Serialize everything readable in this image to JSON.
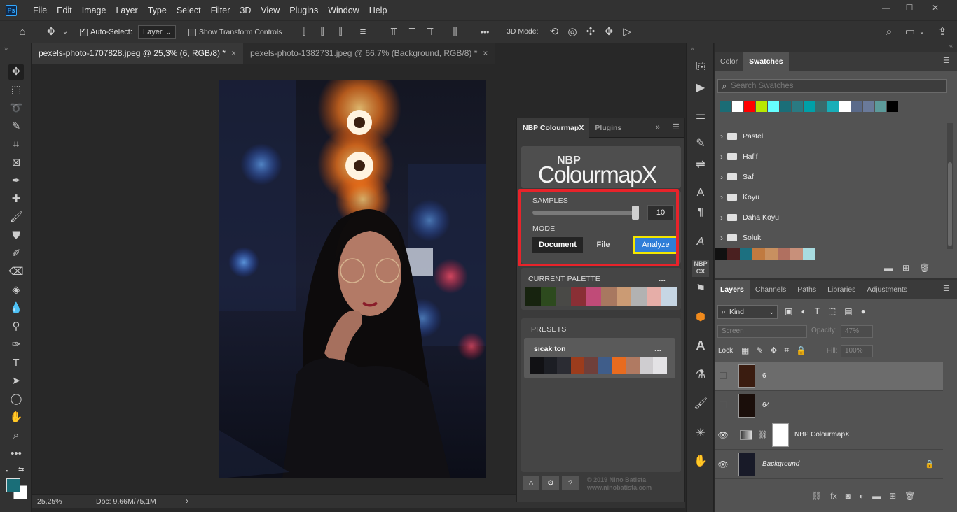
{
  "app": {
    "icon": "Ps"
  },
  "menu": [
    "File",
    "Edit",
    "Image",
    "Layer",
    "Type",
    "Select",
    "Filter",
    "3D",
    "View",
    "Plugins",
    "Window",
    "Help"
  ],
  "window_controls": {
    "minimize": "—",
    "maximize": "☐",
    "close": "✕"
  },
  "options_bar": {
    "auto_select_label": "Auto-Select:",
    "auto_select_value": "Layer",
    "show_transform_label": "Show Transform Controls",
    "mode_3d_label": "3D Mode:",
    "more": "•••"
  },
  "doc_tabs": [
    {
      "label": "pexels-photo-1707828.jpeg @ 25,3% (6, RGB/8) *",
      "close": "×",
      "active": true
    },
    {
      "label": "pexels-photo-1382731.jpeg @ 66,7% (Background, RGB/8) *",
      "close": "×",
      "active": false
    }
  ],
  "status": {
    "zoom": "25,25%",
    "doc": "Doc: 9,66M/75,1M",
    "arrow": "›"
  },
  "nbp_panel": {
    "tabs": [
      "NBP ColourmapX",
      "Plugins"
    ],
    "logo_small": "NBP",
    "logo_main": "ColourmapX",
    "samples_label": "SAMPLES",
    "samples_value": "10",
    "samples_fraction": 1.0,
    "mode_label": "MODE",
    "mode_document": "Document",
    "mode_file": "File",
    "analyze_button": "Analyze",
    "current_palette_label": "CURRENT PALETTE",
    "more": "...",
    "current_palette": [
      "#17230f",
      "#2d4a1e",
      "#494946",
      "#8a2f35",
      "#c04b78",
      "#a87860",
      "#cb9b74",
      "#b2b2b2",
      "#e6aea8",
      "#c6d6e4"
    ],
    "presets_label": "PRESETS",
    "preset_name": "sıcak ton",
    "preset_palette": [
      "#111114",
      "#1c1e24",
      "#2b2c33",
      "#9c3c1c",
      "#6f3f3a",
      "#3f5d8a",
      "#e86b1f",
      "#b07a62",
      "#cfcdd0",
      "#e3e2e5"
    ],
    "copyright_line1": "© 2019 Nino Batista",
    "copyright_line2": "www.ninobatista.com"
  },
  "colors": {
    "highlight_red": "#e8232a",
    "highlight_yellow": "#f3e600",
    "analyze_blue": "#2f7ed8",
    "foreground": "#1a6e78",
    "background_swatch": "#ffffff"
  },
  "swatches_panel": {
    "tabs": [
      "Color",
      "Swatches"
    ],
    "search_placeholder": "Search Swatches",
    "recent": [
      "#1b6c75",
      "#ffffff",
      "#ff0000",
      "#b8e800",
      "#66ffff",
      "#1a6e78",
      "#2a7a82",
      "#00a0a8",
      "#3a6a6c",
      "#18aeb8",
      "#ffffff",
      "#5a6a8a",
      "#6a7a9a",
      "#5c9a9a",
      "#000000"
    ],
    "folders": [
      "Pastel",
      "Hafif",
      "Saf",
      "Koyu",
      "Daha Koyu",
      "Soluk"
    ],
    "bottom_row": [
      "#111111",
      "#4a2020",
      "#1c7080",
      "#c07a40",
      "#c89060",
      "#b07060",
      "#c8907a",
      "#a8dce0"
    ]
  },
  "layers_panel": {
    "tabs": [
      "Layers",
      "Channels",
      "Paths",
      "Libraries",
      "Adjustments"
    ],
    "kind": "Kind",
    "blend_mode": "Screen",
    "opacity_label": "Opacity:",
    "opacity_value": "47%",
    "lock_label": "Lock:",
    "fill_label": "Fill:",
    "fill_value": "100%",
    "layers": [
      {
        "name": "6",
        "visible": false,
        "selected": true
      },
      {
        "name": "64",
        "visible": false,
        "selected": false
      },
      {
        "name": "NBP ColourmapX",
        "visible": true,
        "selected": false
      },
      {
        "name": "Background",
        "visible": true,
        "selected": false
      }
    ]
  }
}
